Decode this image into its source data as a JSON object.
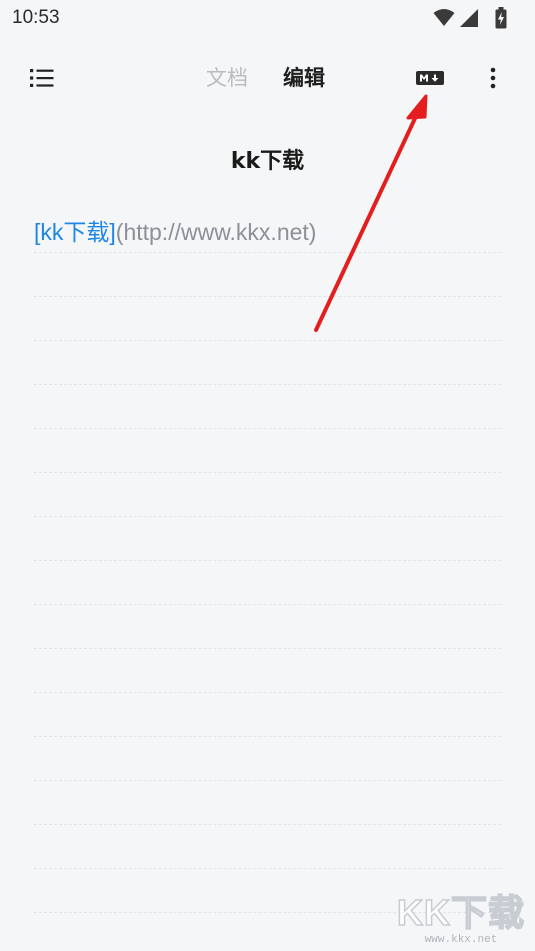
{
  "status_bar": {
    "time": "10:53",
    "icons": [
      "wifi-icon",
      "signal-icon",
      "battery-charging-icon"
    ]
  },
  "toolbar": {
    "menu_icon": "list-menu-icon",
    "tabs": [
      {
        "label": "文档",
        "active": false
      },
      {
        "label": "编辑",
        "active": true
      }
    ],
    "markdown_icon": "markdown-icon",
    "more_icon": "more-vertical-icon"
  },
  "editor": {
    "title": "kk下载",
    "content": {
      "link_text": "[kk下载]",
      "link_url": "(http://www.kkx.net)"
    }
  },
  "colors": {
    "background": "#f5f6f8",
    "link": "#1e86e3",
    "url": "#8c9097",
    "arrow": "#e41e1e",
    "inactive_tab": "#b9bcc1"
  },
  "watermark": {
    "main": "KK下载",
    "sub": "www.kkx.net"
  }
}
